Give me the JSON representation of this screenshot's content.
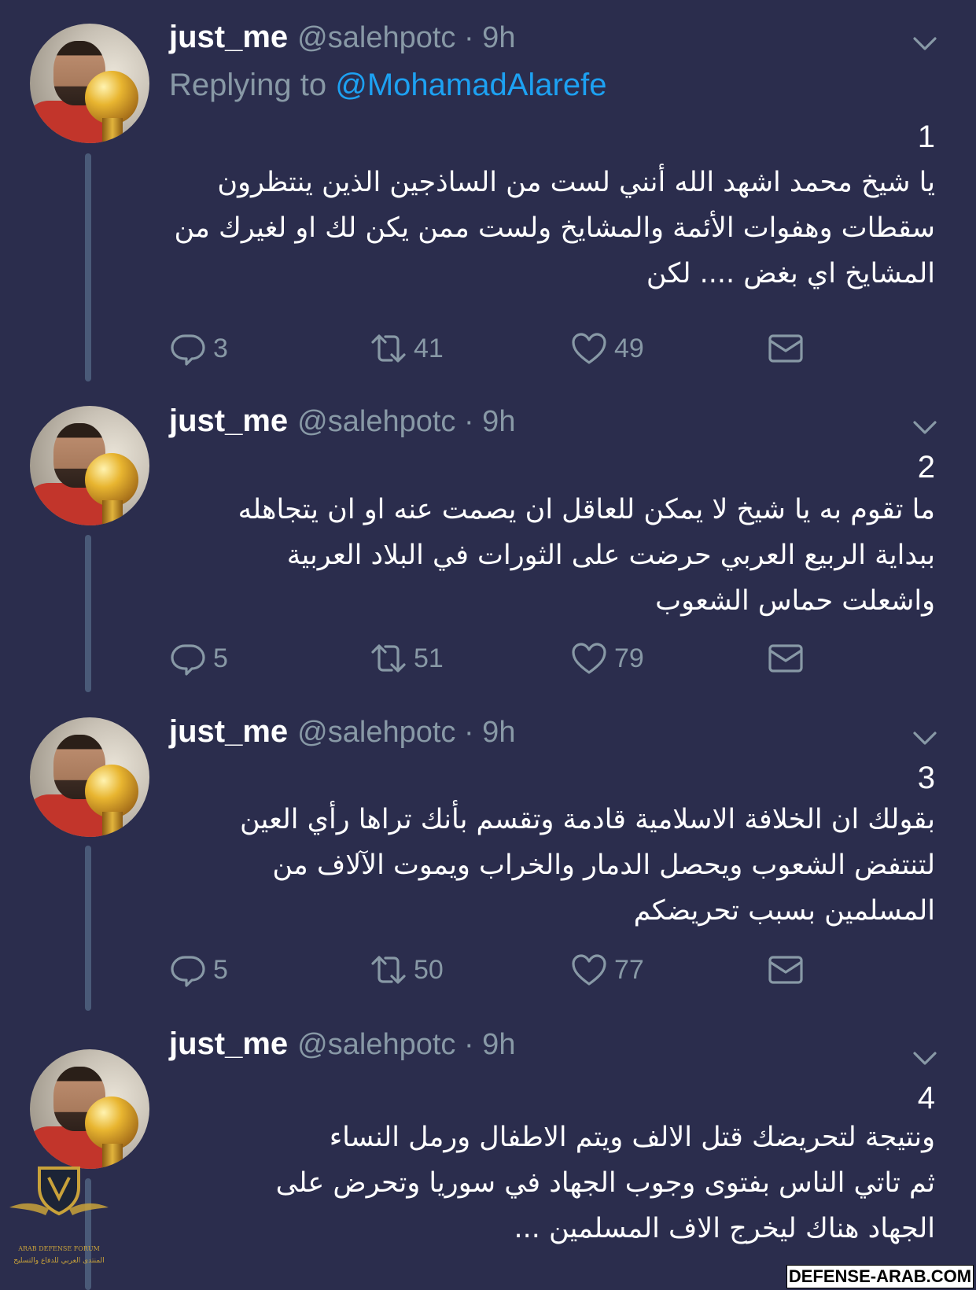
{
  "tweets": [
    {
      "name": "just_me",
      "handle": "@salehpotc · 9h",
      "replying_prefix": "Replying to ",
      "replying_to": "@MohamadAlarefe",
      "number": "1",
      "lines": [
        "يا شيخ محمد اشهد الله أنني لست من الساذجين الذين ينتظرون",
        "سقطات وهفوات الأئمة والمشايخ ولست ممن يكن لك او لغيرك من",
        "المشايخ اي بغض .... لكن"
      ],
      "replies": "3",
      "retweets": "41",
      "likes": "49"
    },
    {
      "name": "just_me",
      "handle": "@salehpotc · 9h",
      "number": "2",
      "lines": [
        "ما تقوم به يا شيخ لا يمكن للعاقل ان يصمت عنه او ان يتجاهله",
        "ببداية الربيع العربي حرضت على الثورات في البلاد العربية",
        "واشعلت حماس الشعوب"
      ],
      "replies": "5",
      "retweets": "51",
      "likes": "79"
    },
    {
      "name": "just_me",
      "handle": "@salehpotc · 9h",
      "number": "3",
      "lines": [
        "بقولك ان الخلافة الاسلامية قادمة وتقسم بأنك تراها رأي العين",
        "لتنتفض الشعوب ويحصل الدمار والخراب ويموت الآلاف من",
        "المسلمين بسبب تحريضكم"
      ],
      "replies": "5",
      "retweets": "50",
      "likes": "77"
    },
    {
      "name": "just_me",
      "handle": "@salehpotc · 9h",
      "number": "4",
      "lines": [
        "ونتيجة لتحريضك قتل الالف ويتم الاطفال ورمل النساء",
        "ثم تاتي الناس بفتوى وجوب الجهاد في سوريا وتحرض على",
        "الجهاد هناك ليخرج الاف المسلمين ..."
      ]
    }
  ],
  "watermark": {
    "text_en": "ARAB DEFENSE FORUM",
    "text_ar": "المنتدى العربي للدفاع والتسليح"
  },
  "site_tag": "DEFENSE-ARAB.COM",
  "icons": [
    "reply-icon",
    "retweet-icon",
    "like-icon",
    "dm-icon",
    "chevron-down-icon"
  ],
  "colors": {
    "background": "#2b2d4d",
    "secondary_text": "#8899a6",
    "link": "#1da1f2"
  }
}
